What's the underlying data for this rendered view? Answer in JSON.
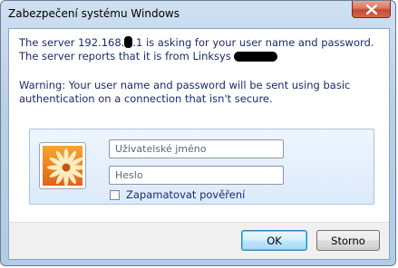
{
  "window": {
    "title": "Zabezpečení systému Windows",
    "close_icon": "close-icon"
  },
  "message": {
    "line1_part1": "The server 192.168.",
    "line1_part2": ".1 is asking for your user name and password. The server reports that it is from Linksys",
    "warning": "Warning: Your user name and password will be sent using basic authentication on a connection that isn't secure."
  },
  "credentials": {
    "avatar_icon": "user-tile-flower-icon",
    "username_placeholder": "Uživatelské jméno",
    "password_placeholder": "Heslo",
    "remember_label": "Zapamatovat pověření",
    "remember_checked": false
  },
  "buttons": {
    "ok": "OK",
    "cancel": "Storno"
  },
  "colors": {
    "text_blue": "#1e2a6e",
    "close_red": "#c44a2f",
    "default_button_border": "#3c7fb1"
  }
}
